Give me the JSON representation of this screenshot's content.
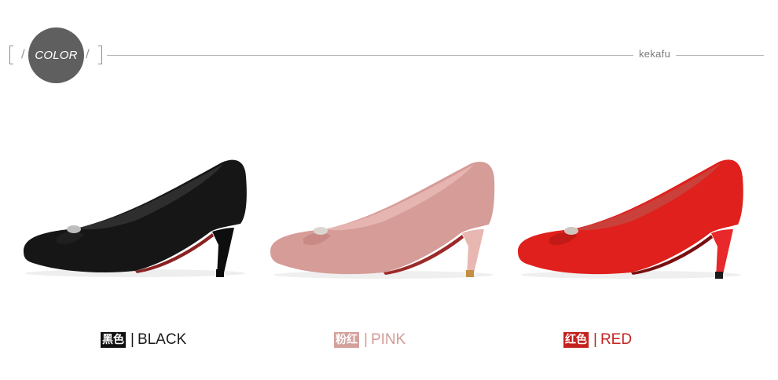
{
  "header": {
    "badge_label": "COLOR",
    "brand": "kekafu"
  },
  "colors_shown": [
    {
      "tag": "黑色",
      "name": "BLACK",
      "tag_bg": "#111111",
      "text_color": "#1a1a1a",
      "swatch": "#161616"
    },
    {
      "tag": "粉红",
      "name": "PINK",
      "tag_bg": "#d3a09c",
      "text_color": "#d19a96",
      "swatch": "#d69c98"
    },
    {
      "tag": "红色",
      "name": "RED",
      "tag_bg": "#c4221e",
      "text_color": "#c4221e",
      "swatch": "#e0201c"
    }
  ],
  "separator": "|"
}
